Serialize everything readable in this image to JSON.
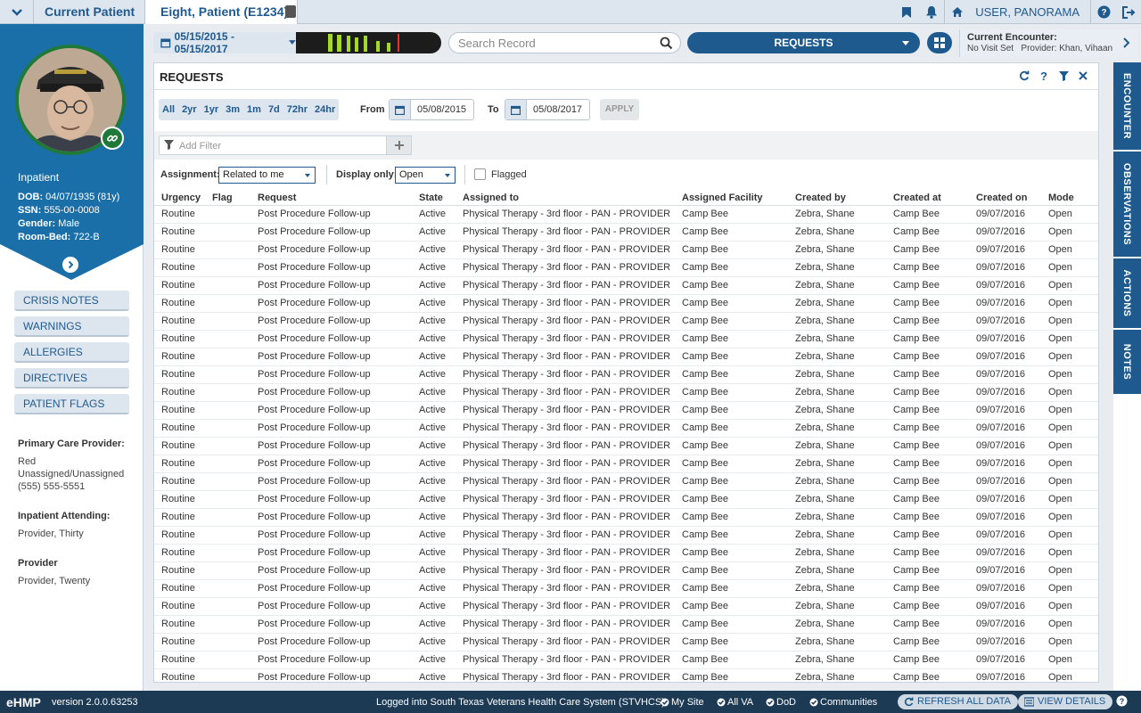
{
  "topbar": {
    "current_patient_label": "Current Patient",
    "patient_tab": "Eight, Patient (E1234)",
    "user_label": "USER, PANORAMA"
  },
  "patient": {
    "status": "Inpatient",
    "dob_label": "DOB:",
    "dob": "04/07/1935 (81y)",
    "ssn_label": "SSN:",
    "ssn": "555-00-0008",
    "gender_label": "Gender:",
    "gender": "Male",
    "roombed_label": "Room-Bed:",
    "roombed": "722-B"
  },
  "sidebar": {
    "buttons": [
      "CRISIS NOTES",
      "WARNINGS",
      "ALLERGIES",
      "DIRECTIVES",
      "PATIENT FLAGS"
    ],
    "pcp_label": "Primary Care Provider:",
    "pcp_line1": "Red",
    "pcp_line2": "Unassigned/Unassigned",
    "pcp_line3": "(555) 555-5551",
    "attending_label": "Inpatient Attending:",
    "attending": "Provider, Thirty",
    "provider_label": "Provider",
    "provider": "Provider, Twenty"
  },
  "header": {
    "date_range": "05/15/2015 - 05/15/2017",
    "search_placeholder": "Search Record",
    "workspace": "REQUESTS",
    "encounter_title": "Current Encounter:",
    "encounter_visit": "No Visit Set",
    "encounter_provider": "Provider: Khan, Vihaan"
  },
  "tray": [
    "ENCOUNTER",
    "OBSERVATIONS",
    "ACTIONS",
    "NOTES"
  ],
  "panel": {
    "title": "REQUESTS",
    "ranges": [
      "All",
      "2yr",
      "1yr",
      "3m",
      "1m",
      "7d",
      "72hr",
      "24hr"
    ],
    "from_label": "From",
    "from_date": "05/08/2015",
    "to_label": "To",
    "to_date": "05/08/2017",
    "apply": "APPLY",
    "filter_placeholder": "Add Filter",
    "assignment_label": "Assignment:",
    "assignment_value": "Related to me",
    "display_label": "Display only:",
    "display_value": "Open",
    "flagged_label": "Flagged",
    "columns": [
      "Urgency",
      "Flag",
      "Request",
      "State",
      "Assigned to",
      "Assigned Facility",
      "Created by",
      "Created at",
      "Created on",
      "Mode"
    ],
    "row": {
      "urgency": "Routine",
      "flag": "",
      "request": "Post Procedure Follow-up",
      "state": "Active",
      "assigned_to": "Physical Therapy - 3rd floor - PAN - PROVIDER",
      "facility": "Camp Bee",
      "created_by": "Zebra, Shane",
      "created_at": "Camp Bee",
      "created_on": "09/07/2016",
      "mode": "Open"
    }
  },
  "footer": {
    "brand": "eHMP",
    "version": "version 2.0.0.63253",
    "logged": "Logged into South Texas Veterans Health Care System (STVHCS)",
    "sites": [
      "My Site",
      "All VA",
      "DoD",
      "Communities"
    ],
    "refresh": "REFRESH ALL DATA",
    "view_details": "VIEW DETAILS"
  },
  "colors": {
    "primary": "#1f5a8f",
    "sidebar_blue": "#1a6fa8",
    "footer": "#1d3a55",
    "avatar_ring": "#1f7a3a"
  }
}
